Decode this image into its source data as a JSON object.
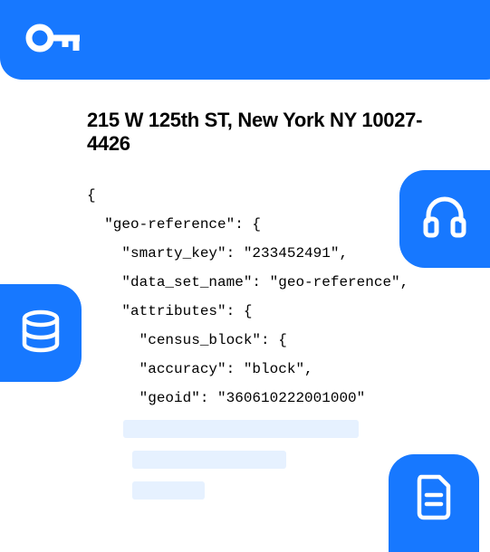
{
  "address": "215 W 125th ST, New York NY 10027-4426",
  "code": {
    "l1": "{",
    "l2": "  \"geo-reference\": {",
    "l3": "    \"smarty_key\": \"233452491\",",
    "l4": "    \"data_set_name\": \"geo-reference\",",
    "l5": "    \"attributes\": {",
    "l6": "      \"census_block\": {",
    "l7": "      \"accuracy\": \"block\",",
    "l8": "      \"geoid\": \"360610222001000\""
  }
}
